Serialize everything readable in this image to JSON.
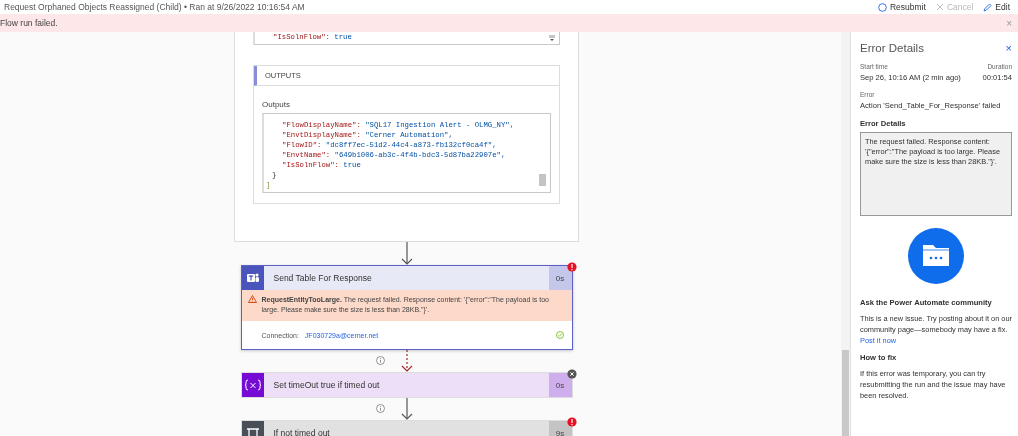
{
  "header": {
    "title": "Request Orphaned Objects Reassigned (Child) • Ran at 9/26/2022 10:16:54 AM",
    "actions": [
      {
        "kind": "resubmit",
        "label": "Resubmit",
        "disabled": false
      },
      {
        "kind": "cancel",
        "label": "Cancel",
        "disabled": true
      },
      {
        "kind": "edit",
        "label": "Edit",
        "disabled": false
      }
    ]
  },
  "banner": {
    "text": "Flow run failed.",
    "close": "×"
  },
  "card": {
    "input_tail": [
      {
        "kind": "pair",
        "key": "\"IsSolnFlow\": ",
        "value": "true"
      }
    ],
    "outputs_header": "OUTPUTS",
    "outputs_label": "Outputs",
    "lines": [
      {
        "kind": "pair",
        "key": "\"FlowDisplayName\": ",
        "value": "\"SQL17 Ingestion Alert - OLMG_NY\","
      },
      {
        "kind": "pair",
        "key": "\"EnvtDisplayName\": ",
        "value": "\"Cerner Automation\","
      },
      {
        "kind": "pair",
        "key": "\"FlowID\": ",
        "value": "\"dc8ff7ec-51d2-44c4-a873-fb132cf0ca4f\","
      },
      {
        "kind": "pair",
        "key": "\"EnvtName\": ",
        "value": "\"649b1006-ab3c-4f4b-bdc3-5d87ba22907e\","
      },
      {
        "kind": "pair",
        "key": "\"IsSolnFlow\": ",
        "value": "true"
      },
      {
        "kind": "brace",
        "key": "}"
      },
      {
        "kind": "bracket",
        "key": "]"
      }
    ]
  },
  "steps": [
    {
      "kind": "teams",
      "title": "Send Table For Response",
      "duration": "0s",
      "failed": true,
      "skipped": false,
      "selected": true,
      "error": "**RequestEntityTooLarge.** The request failed. Response content: '{\"error\":\"The payload is too large. Please make sure the size is less than 28KB.\"}'.",
      "connection_label": "Connection:",
      "connection": "JF030729a@cerner.net"
    },
    {
      "kind": "variable",
      "title": "Set timeOut true if timed out",
      "duration": "0s",
      "failed": false,
      "skipped": true,
      "selected": false
    },
    {
      "kind": "condition",
      "title": "If not timed out",
      "duration": "9s",
      "failed": true,
      "skipped": false,
      "selected": false
    }
  ],
  "panel": {
    "title": "Error Details",
    "close": "×",
    "start_label": "Start time",
    "start_value": "Sep 26, 10:16 AM (2 min ago)",
    "duration_label": "Duration",
    "duration_value": "00:01:54",
    "error_label": "Error",
    "error_value": "Action 'Send_Table_For_Response' failed",
    "details_label": "Error Details",
    "details_text": "The request failed. Response content: '{\"error\":\"The payload is too large. Please make sure the size is less than 28KB.\"}'.",
    "community_heading": "Ask the Power Automate community",
    "community_text": "This is a new issue. Try posting about it on our community page—somebody may have a fix.",
    "community_link": "Post it now",
    "fix_heading": "How to fix",
    "fix_text": "If this error was temporary, you can try resubmitting the run and the issue may have been resolved."
  }
}
